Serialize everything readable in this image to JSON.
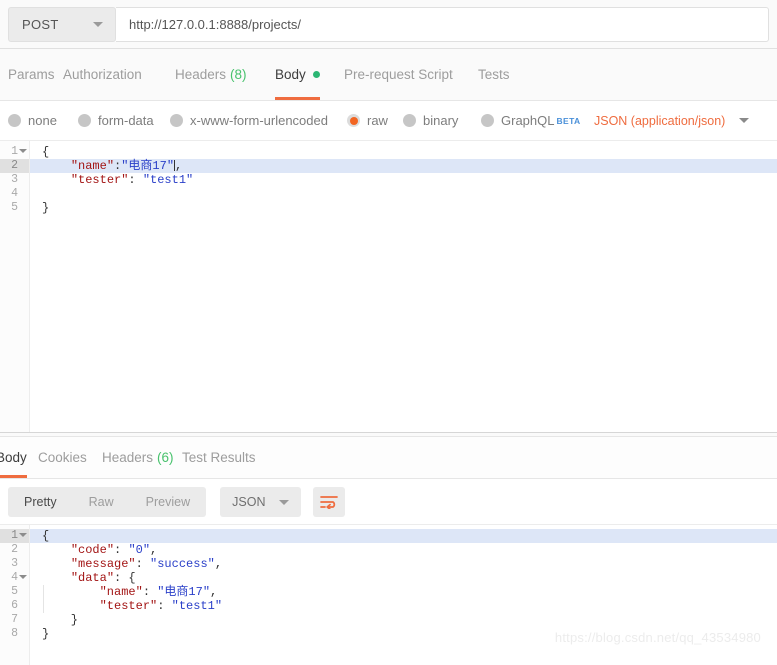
{
  "request": {
    "method": "POST",
    "url": "http://127.0.0.1:8888/projects/",
    "tabs": [
      {
        "label": "Params",
        "count": "",
        "active": false,
        "dot": false
      },
      {
        "label": "Authorization",
        "count": "",
        "active": false,
        "dot": false
      },
      {
        "label": "Headers",
        "count": "(8)",
        "active": false,
        "dot": false
      },
      {
        "label": "Body",
        "count": "",
        "active": true,
        "dot": true
      },
      {
        "label": "Pre-request Script",
        "count": "",
        "active": false,
        "dot": false
      },
      {
        "label": "Tests",
        "count": "",
        "active": false,
        "dot": false
      }
    ],
    "body_types": [
      {
        "label": "none",
        "selected": false,
        "beta": ""
      },
      {
        "label": "form-data",
        "selected": false,
        "beta": ""
      },
      {
        "label": "x-www-form-urlencoded",
        "selected": false,
        "beta": ""
      },
      {
        "label": "raw",
        "selected": true,
        "beta": ""
      },
      {
        "label": "binary",
        "selected": false,
        "beta": ""
      },
      {
        "label": "GraphQL",
        "selected": false,
        "beta": "BETA"
      }
    ],
    "content_type": "JSON (application/json)",
    "editor": {
      "active_line": 2,
      "lines": [
        {
          "n": "1",
          "fold": true,
          "tokens": [
            {
              "t": "{",
              "c": "p"
            }
          ]
        },
        {
          "n": "2",
          "fold": false,
          "tokens": [
            {
              "t": "    ",
              "c": "p"
            },
            {
              "t": "\"name\"",
              "c": "k"
            },
            {
              "t": ":",
              "c": "p"
            },
            {
              "t": "\"电商17\"",
              "c": "v"
            },
            {
              "t": ",",
              "c": "p"
            }
          ]
        },
        {
          "n": "3",
          "fold": false,
          "tokens": [
            {
              "t": "    ",
              "c": "p"
            },
            {
              "t": "\"tester\"",
              "c": "k"
            },
            {
              "t": ": ",
              "c": "p"
            },
            {
              "t": "\"test1\"",
              "c": "v"
            }
          ]
        },
        {
          "n": "4",
          "fold": false,
          "tokens": []
        },
        {
          "n": "5",
          "fold": false,
          "tokens": [
            {
              "t": "}",
              "c": "p"
            }
          ]
        }
      ]
    }
  },
  "response": {
    "tabs": [
      {
        "label": "Body",
        "count": "",
        "active": true
      },
      {
        "label": "Cookies",
        "count": "",
        "active": false
      },
      {
        "label": "Headers",
        "count": "(6)",
        "active": false
      },
      {
        "label": "Test Results",
        "count": "",
        "active": false
      }
    ],
    "view_modes": [
      {
        "label": "Pretty",
        "active": true
      },
      {
        "label": "Raw",
        "active": false
      },
      {
        "label": "Preview",
        "active": false
      }
    ],
    "format": "JSON",
    "wrap_icon": "word-wrap-icon",
    "editor": {
      "active_line": 1,
      "lines": [
        {
          "n": "1",
          "fold": true,
          "tokens": [
            {
              "t": "{",
              "c": "p"
            }
          ]
        },
        {
          "n": "2",
          "fold": false,
          "tokens": [
            {
              "t": "    ",
              "c": "p"
            },
            {
              "t": "\"code\"",
              "c": "k"
            },
            {
              "t": ": ",
              "c": "p"
            },
            {
              "t": "\"0\"",
              "c": "v"
            },
            {
              "t": ",",
              "c": "p"
            }
          ]
        },
        {
          "n": "3",
          "fold": false,
          "tokens": [
            {
              "t": "    ",
              "c": "p"
            },
            {
              "t": "\"message\"",
              "c": "k"
            },
            {
              "t": ": ",
              "c": "p"
            },
            {
              "t": "\"success\"",
              "c": "v"
            },
            {
              "t": ",",
              "c": "p"
            }
          ]
        },
        {
          "n": "4",
          "fold": true,
          "tokens": [
            {
              "t": "    ",
              "c": "p"
            },
            {
              "t": "\"data\"",
              "c": "k"
            },
            {
              "t": ": {",
              "c": "p"
            }
          ]
        },
        {
          "n": "5",
          "fold": false,
          "tokens": [
            {
              "t": "        ",
              "c": "p"
            },
            {
              "t": "\"name\"",
              "c": "k"
            },
            {
              "t": ": ",
              "c": "p"
            },
            {
              "t": "\"电商17\"",
              "c": "v"
            },
            {
              "t": ",",
              "c": "p"
            }
          ]
        },
        {
          "n": "6",
          "fold": false,
          "tokens": [
            {
              "t": "        ",
              "c": "p"
            },
            {
              "t": "\"tester\"",
              "c": "k"
            },
            {
              "t": ": ",
              "c": "p"
            },
            {
              "t": "\"test1\"",
              "c": "v"
            }
          ]
        },
        {
          "n": "7",
          "fold": false,
          "tokens": [
            {
              "t": "    }",
              "c": "p"
            }
          ]
        },
        {
          "n": "8",
          "fold": false,
          "tokens": [
            {
              "t": "}",
              "c": "p"
            }
          ]
        }
      ]
    }
  },
  "watermark": "https://blog.csdn.net/qq_43534980",
  "colors": {
    "accent": "#ef6c3f",
    "green": "#48c26d",
    "blue_beta": "#4a90d9",
    "key": "#a31515",
    "value": "#2b40c9",
    "active_line": "#dde6f7"
  }
}
